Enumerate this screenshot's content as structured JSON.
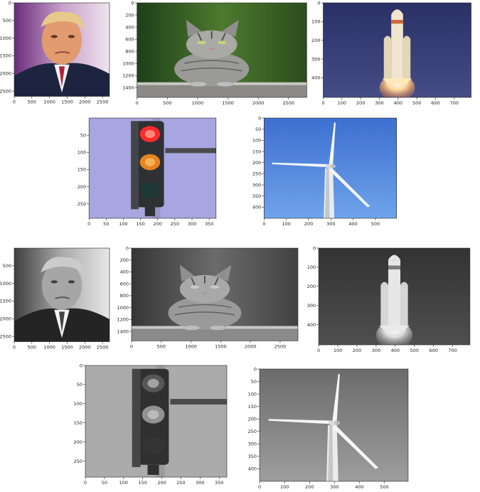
{
  "chart_data": [
    {
      "type": "image",
      "image": "portrait-man-suit-red-tie",
      "mode": "color",
      "xlim": [
        0,
        2700
      ],
      "ylim": [
        2650,
        0
      ],
      "xticks": [
        0,
        500,
        1000,
        1500,
        2000,
        2500
      ],
      "yticks": [
        0,
        500,
        1000,
        1500,
        2000,
        2500
      ]
    },
    {
      "type": "image",
      "image": "tabby-cat-lying",
      "mode": "color",
      "xlim": [
        0,
        2800
      ],
      "ylim": [
        1560,
        0
      ],
      "xticks": [
        0,
        500,
        1000,
        1500,
        2000,
        2500
      ],
      "yticks": [
        0,
        200,
        400,
        600,
        800,
        1000,
        1200,
        1400
      ]
    },
    {
      "type": "image",
      "image": "rocket-launch",
      "mode": "color",
      "xlim": [
        0,
        790
      ],
      "ylim": [
        505,
        0
      ],
      "xticks": [
        0,
        100,
        200,
        300,
        400,
        500,
        600,
        700
      ],
      "yticks": [
        0,
        100,
        200,
        300,
        400
      ]
    },
    {
      "type": "image",
      "image": "traffic-light-red-amber",
      "mode": "color",
      "xlim": [
        0,
        370
      ],
      "ylim": [
        292,
        0
      ],
      "xticks": [
        0,
        50,
        100,
        150,
        200,
        250,
        300,
        350
      ],
      "yticks": [
        50,
        100,
        150,
        200,
        250
      ]
    },
    {
      "type": "image",
      "image": "wind-turbine-blue-sky",
      "mode": "color",
      "xlim": [
        0,
        595
      ],
      "ylim": [
        450,
        0
      ],
      "xticks": [
        0,
        100,
        200,
        300,
        400,
        500
      ],
      "yticks": [
        0,
        50,
        100,
        150,
        200,
        250,
        300,
        350,
        400
      ]
    },
    {
      "type": "image",
      "image": "portrait-man-suit-red-tie",
      "mode": "grayscale",
      "xlim": [
        0,
        2700
      ],
      "ylim": [
        2650,
        0
      ],
      "xticks": [
        0,
        500,
        1000,
        1500,
        2000,
        2500
      ],
      "yticks": [
        500,
        1000,
        1500,
        2000,
        2500
      ]
    },
    {
      "type": "image",
      "image": "tabby-cat-lying",
      "mode": "grayscale",
      "xlim": [
        0,
        2800
      ],
      "ylim": [
        1560,
        0
      ],
      "xticks": [
        0,
        500,
        1000,
        1500,
        2000,
        2500
      ],
      "yticks": [
        0,
        200,
        400,
        600,
        800,
        1000,
        1200,
        1400
      ]
    },
    {
      "type": "image",
      "image": "rocket-launch",
      "mode": "grayscale",
      "xlim": [
        0,
        790
      ],
      "ylim": [
        505,
        0
      ],
      "xticks": [
        0,
        100,
        200,
        300,
        400,
        500,
        600,
        700
      ],
      "yticks": [
        0,
        100,
        200,
        300,
        400
      ]
    },
    {
      "type": "image",
      "image": "traffic-light-red-amber",
      "mode": "grayscale",
      "xlim": [
        0,
        370
      ],
      "ylim": [
        292,
        0
      ],
      "xticks": [
        0,
        50,
        100,
        150,
        200,
        250,
        300,
        350
      ],
      "yticks": [
        0,
        50,
        100,
        150,
        200,
        250
      ]
    },
    {
      "type": "image",
      "image": "wind-turbine-blue-sky",
      "mode": "grayscale",
      "xlim": [
        0,
        595
      ],
      "ylim": [
        450,
        0
      ],
      "xticks": [
        0,
        100,
        200,
        300,
        400,
        500
      ],
      "yticks": [
        0,
        50,
        100,
        150,
        200,
        250,
        300,
        350,
        400
      ]
    }
  ]
}
